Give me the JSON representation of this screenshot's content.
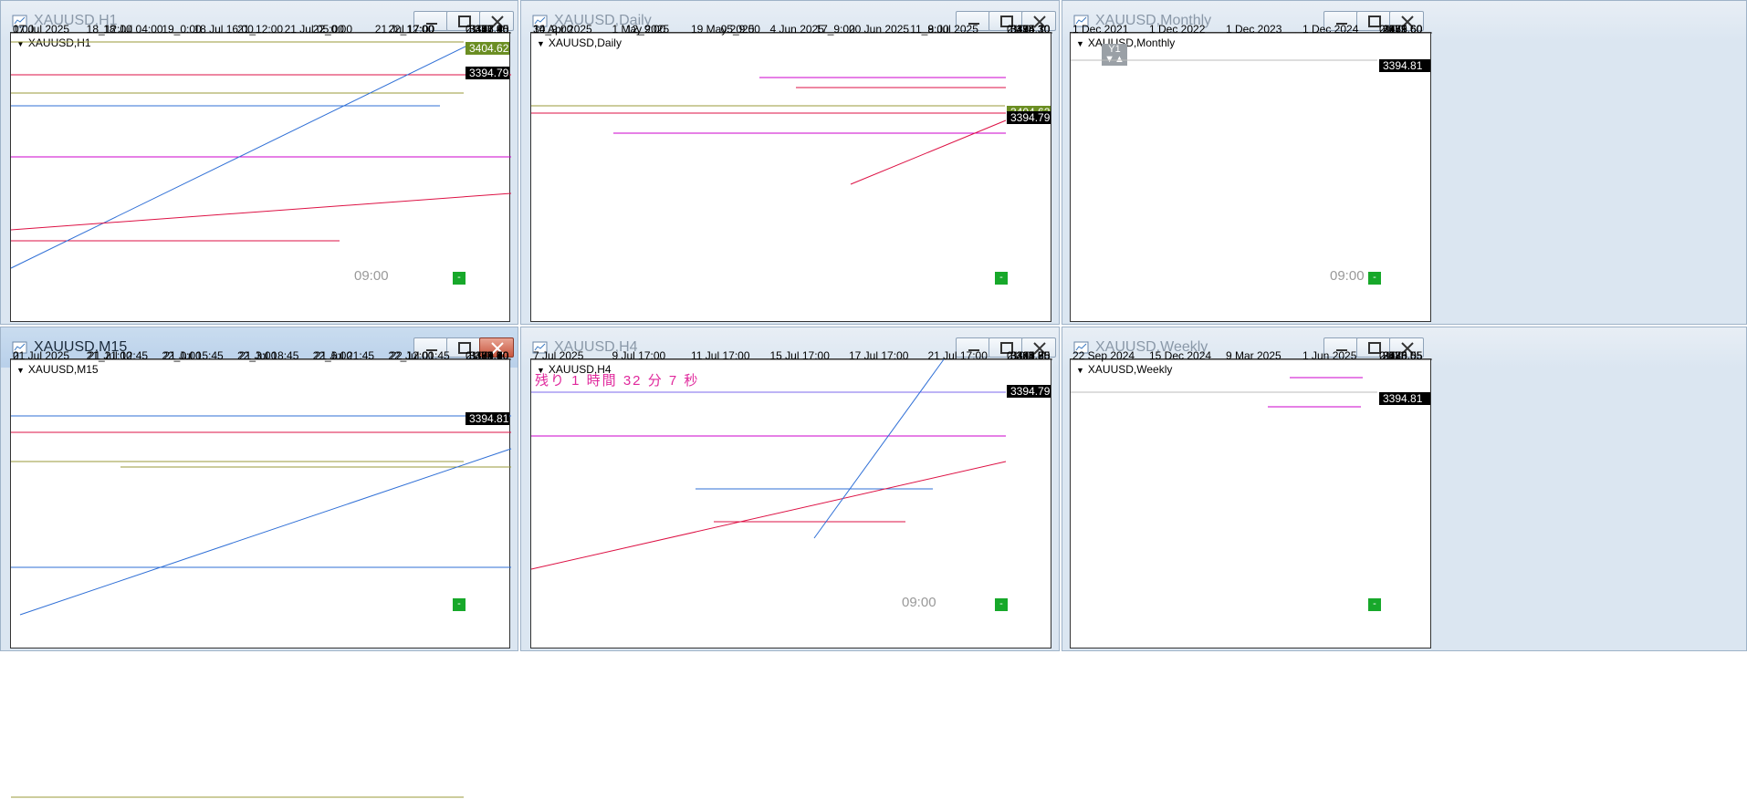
{
  "charts": [
    {
      "id": "h1",
      "window_title": "XAUUSD,H1",
      "symbol_label": "XAUUSD,H1",
      "active": false,
      "y_ticks": [
        "3401.15",
        "3386.40",
        "3371.65",
        "3356.90",
        "3342.40",
        "3327.65",
        "3312.90"
      ],
      "tag_green": "3404.62",
      "tag_price": "3394.79",
      "x_top": [
        "0:00",
        "18_12:00",
        "19_0:00",
        "21_12:00",
        "22_0:00",
        "22_12:00"
      ],
      "x_bottom": [
        "17 Jul 2025",
        "18 Jul 04:00",
        "18 Jul 16:00",
        "21 Jul 05:00",
        "21 Jul 17:00"
      ],
      "time_label": "09:00",
      "corner": "2",
      "corner2": "0",
      "scale": "100"
    },
    {
      "id": "daily",
      "window_title": "XAUUSD,Daily",
      "symbol_label": "XAUUSD,Daily",
      "active": false,
      "y_ticks": [
        "3495.30",
        "3435.30",
        "3375.30",
        "3314.10",
        "3254.10",
        "3194.10",
        "3134.10"
      ],
      "tag_green": "3404.62",
      "tag_price": "3394.79",
      "x_top": [
        "30_9:00",
        "12_9:00",
        "05_9:00",
        "17_9:00",
        "11_9:00"
      ],
      "x_bottom": [
        "14 Apr 2025",
        "1 May 2025",
        "19 May 2025",
        "4 Jun 2025",
        "20 Jun 2025",
        "8 Jul 2025"
      ],
      "corner": "2",
      "corner2": "0",
      "scale": "100"
    },
    {
      "id": "monthly",
      "window_title": "XAUUSD,Monthly",
      "symbol_label": "XAUUSD,Monthly",
      "active": false,
      "y1_label": "Y1",
      "y_ticks": [
        "3469.60",
        "3169.60",
        "2875.60",
        "2575.60",
        "2275.60",
        "1975.60",
        "1681.60"
      ],
      "tag_price": "3394.81",
      "x_bottom": [
        "1 Dec 2021",
        "1 Dec 2022",
        "1 Dec 2023",
        "1 Dec 2024"
      ],
      "time_label": "09:00",
      "corner": "2",
      "corner2": "0",
      "scale": "100"
    },
    {
      "id": "m15",
      "window_title": "XAUUSD,M15",
      "symbol_label": "XAUUSD,M15",
      "active": true,
      "y_ticks": [
        "3401.90",
        "3395.60",
        "3389.30",
        "3383.00",
        "3376.70",
        "3370.40",
        "3364.10"
      ],
      "tag_price": "3394.81",
      "x_top": [
        "0",
        "21_21:00",
        "22_0:00",
        "22_3:00",
        "22_6:00",
        "22_12:00"
      ],
      "x_bottom": [
        "21 Jul 2025",
        "21 Jul 12:45",
        "21 Jul 15:45",
        "21 Jul 18:45",
        "21 Jul 21:45",
        "22 Jul 01:45"
      ],
      "corner": "2",
      "corner2": "0",
      "scale": "100"
    },
    {
      "id": "h4",
      "window_title": "XAUUSD,H4",
      "symbol_label": "XAUUSD,H4",
      "active": false,
      "countdown": "残り 1 時間 32 分 7 秒",
      "y_ticks": [
        "3400.80",
        "3381.55",
        "3362.65",
        "3343.75",
        "3324.85",
        "3305.95",
        "3286.70"
      ],
      "tag_price": "3394.79",
      "x_bottom": [
        "7 Jul 2025",
        "9 Jul 17:00",
        "11 Jul 17:00",
        "15 Jul 17:00",
        "17 Jul 17:00",
        "21 Jul 17:00"
      ],
      "time_label": "09:00",
      "corner": "2",
      "corner2": "0",
      "scale": "100"
    },
    {
      "id": "weekly",
      "window_title": "XAUUSD,Weekly",
      "symbol_label": "XAUUSD,Weekly",
      "active": false,
      "y_ticks": [
        "3485.55",
        "3333.05",
        "3180.55",
        "3028.05",
        "2875.55",
        "2723.05",
        "2570.55"
      ],
      "tag_price": "3394.81",
      "x_bottom": [
        "22 Sep 2024",
        "15 Dec 2024",
        "9 Mar 2025",
        "1 Jun 2025"
      ],
      "corner": "2",
      "corner2": "0",
      "scale": "100"
    }
  ],
  "colors": {
    "price_tag_bg": "#000000",
    "green_tag_bg": "#6b8e23",
    "magenta_line": "#cc00cc",
    "red_line": "#dd1144",
    "blue_line": "#2f6fd6",
    "olive_line": "#9a9a3a",
    "pink_vline": "#ff3ca0"
  }
}
